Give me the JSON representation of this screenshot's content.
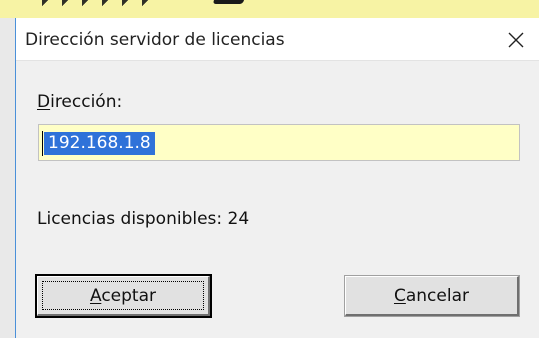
{
  "window": {
    "title": "Dirección servidor de licencias",
    "close_glyph": "✕",
    "close_icon": "close-icon"
  },
  "form": {
    "address_label_accel": "D",
    "address_label_rest": "irección:",
    "address_value": "192.168.1.8",
    "licenses_text": "Licencias disponibles: 24"
  },
  "buttons": {
    "ok_accel": "A",
    "ok_rest": "ceptar",
    "cancel_accel": "C",
    "cancel_rest": "ancelar"
  },
  "colors": {
    "input_background": "#ffffc6",
    "selection": "#2f72d9",
    "top_strip": "#f7f3a4",
    "window_border": "#4a90d9"
  }
}
